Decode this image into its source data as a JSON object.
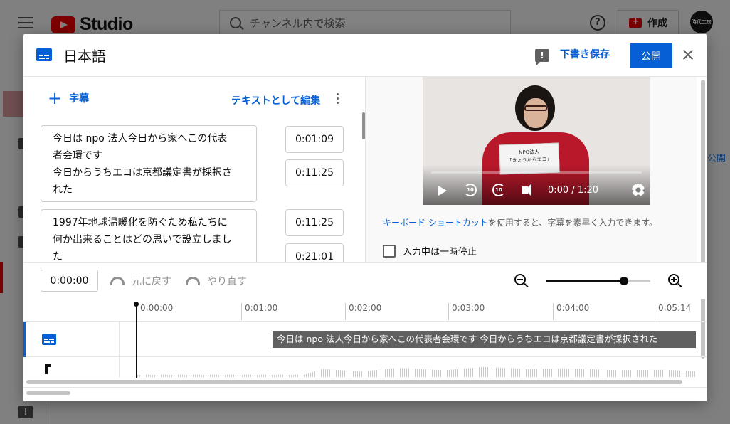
{
  "background": {
    "app_name": "Studio",
    "search_placeholder": "チャンネル内で検索",
    "help_symbol": "?",
    "create_label": "作成",
    "avatar_text": "時代工房",
    "side_link": "公開",
    "feedback_symbol": "!"
  },
  "dialog": {
    "title": "日本語",
    "feedback_symbol": "!",
    "draft_save": "下書き保存",
    "publish": "公開"
  },
  "editor": {
    "add_subtitle": "字幕",
    "add_symbol": "+",
    "edit_as_text": "テキストとして編集",
    "cues": [
      {
        "text_lines": [
          "今日は npo 法人今日から家へこの代表",
          "者会環です",
          "今日からうちエコは京都議定書が採択さ",
          "れた"
        ],
        "start": "0:01:09",
        "end": "0:11:25"
      },
      {
        "text_lines": [
          "1997年地球温暖化を防ぐため私たちに",
          "何か出来ることはどの思いで設立しまし",
          "た"
        ],
        "start": "0:11:25",
        "end": "0:21:01"
      }
    ]
  },
  "player": {
    "sign_line1": "NPO法人",
    "sign_line2": "「きょうからエコ」",
    "time_display": "0:00 / 1:20",
    "rewind_label": "10",
    "forward_label": "10"
  },
  "hints": {
    "shortcut_link": "キーボード ショートカット",
    "shortcut_rest": "を使用すると、字幕を素早く入力できます。",
    "pause_while_typing": "入力中は一時停止"
  },
  "timeline": {
    "current_time": "0:00:00",
    "undo": "元に戻す",
    "redo": "やり直す",
    "zoom_level": 0.75,
    "ticks": [
      "0:00:00",
      "0:01:00",
      "0:02:00",
      "0:03:00",
      "0:04:00",
      "0:05:14"
    ],
    "subtitle_block": "今日は npo 法人今日から家へこの代表者会環です 今日からうちエコは京都議定書が採択された"
  }
}
